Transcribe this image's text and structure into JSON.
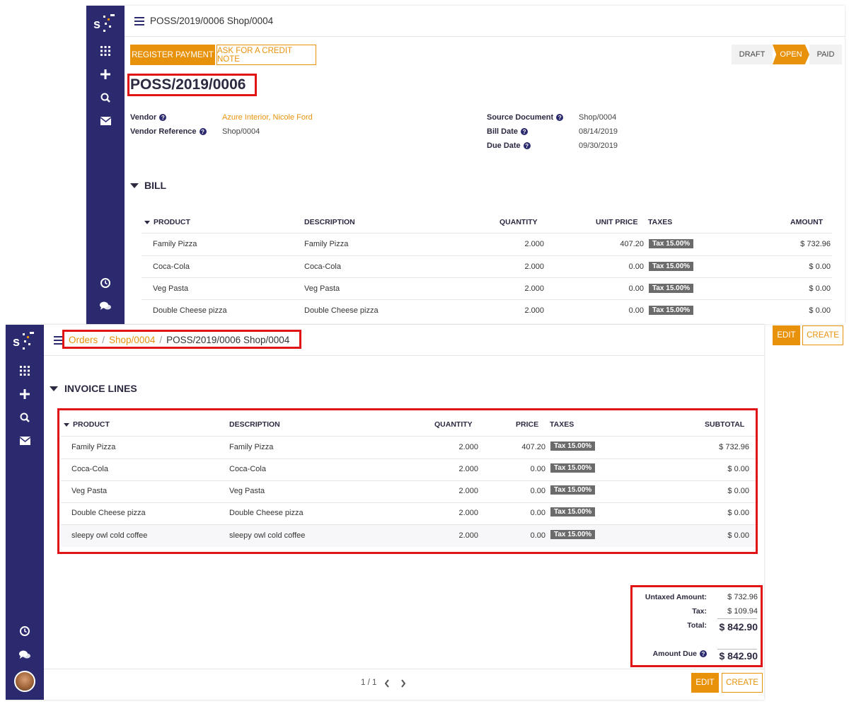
{
  "back_window": {
    "breadcrumb": "POSS/2019/0006 Shop/0004",
    "buttons": {
      "register_payment": "REGISTER PAYMENT",
      "credit_note": "ASK FOR A CREDIT NOTE"
    },
    "status": {
      "draft": "DRAFT",
      "open": "OPEN",
      "paid": "PAID"
    },
    "title": "POSS/2019/0006",
    "fields": {
      "vendor_label": "Vendor",
      "vendor_value": "Azure Interior, Nicole Ford",
      "vendor_ref_label": "Vendor Reference",
      "vendor_ref_value": "Shop/0004",
      "source_label": "Source Document",
      "source_value": "Shop/0004",
      "bill_date_label": "Bill Date",
      "bill_date_value": "08/14/2019",
      "due_date_label": "Due Date",
      "due_date_value": "09/30/2019"
    },
    "section": "BILL",
    "columns": {
      "product": "PRODUCT",
      "description": "DESCRIPTION",
      "quantity": "QUANTITY",
      "unit_price": "UNIT PRICE",
      "taxes": "TAXES",
      "amount": "AMOUNT"
    },
    "rows": [
      {
        "product": "Family Pizza",
        "description": "Family Pizza",
        "quantity": "2.000",
        "price": "407.20",
        "tax": "Tax 15.00%",
        "amount": "$ 732.96"
      },
      {
        "product": "Coca-Cola",
        "description": "Coca-Cola",
        "quantity": "2.000",
        "price": "0.00",
        "tax": "Tax 15.00%",
        "amount": "$ 0.00"
      },
      {
        "product": "Veg Pasta",
        "description": "Veg Pasta",
        "quantity": "2.000",
        "price": "0.00",
        "tax": "Tax 15.00%",
        "amount": "$ 0.00"
      },
      {
        "product": "Double Cheese pizza",
        "description": "Double Cheese pizza",
        "quantity": "2.000",
        "price": "0.00",
        "tax": "Tax 15.00%",
        "amount": "$ 0.00"
      }
    ],
    "edit": "EDIT",
    "create": "CREATE"
  },
  "front_window": {
    "breadcrumb": {
      "orders": "Orders",
      "sep1": "/",
      "shop": "Shop/0004",
      "sep2": "/",
      "current": "POSS/2019/0006 Shop/0004"
    },
    "section": "INVOICE LINES",
    "columns": {
      "product": "PRODUCT",
      "description": "DESCRIPTION",
      "quantity": "QUANTITY",
      "price": "PRICE",
      "taxes": "TAXES",
      "subtotal": "SUBTOTAL"
    },
    "rows": [
      {
        "product": "Family Pizza",
        "description": "Family Pizza",
        "quantity": "2.000",
        "price": "407.20",
        "tax": "Tax 15.00%",
        "subtotal": "$ 732.96"
      },
      {
        "product": "Coca-Cola",
        "description": "Coca-Cola",
        "quantity": "2.000",
        "price": "0.00",
        "tax": "Tax 15.00%",
        "subtotal": "$ 0.00"
      },
      {
        "product": "Veg Pasta",
        "description": "Veg Pasta",
        "quantity": "2.000",
        "price": "0.00",
        "tax": "Tax 15.00%",
        "subtotal": "$ 0.00"
      },
      {
        "product": "Double Cheese pizza",
        "description": "Double Cheese pizza",
        "quantity": "2.000",
        "price": "0.00",
        "tax": "Tax 15.00%",
        "subtotal": "$ 0.00"
      },
      {
        "product": "sleepy owl cold coffee",
        "description": "sleepy owl cold coffee",
        "quantity": "2.000",
        "price": "0.00",
        "tax": "Tax 15.00%",
        "subtotal": "$ 0.00"
      }
    ],
    "totals": {
      "untaxed_label": "Untaxed Amount:",
      "untaxed_value": "$ 732.96",
      "tax_label": "Tax:",
      "tax_value": "$ 109.94",
      "total_label": "Total:",
      "total_value": "$ 842.90",
      "due_label": "Amount Due",
      "due_value": "$ 842.90"
    },
    "pager": "1 / 1",
    "edit": "EDIT",
    "create": "CREATE"
  },
  "colors": {
    "sidebar": "#2b2a6f",
    "accent": "#e8920c",
    "highlight": "#e01414"
  },
  "sidebar_icons": [
    "apps-grid-icon",
    "plus-icon",
    "search-icon",
    "mail-icon",
    "clock-icon",
    "chat-icon"
  ]
}
